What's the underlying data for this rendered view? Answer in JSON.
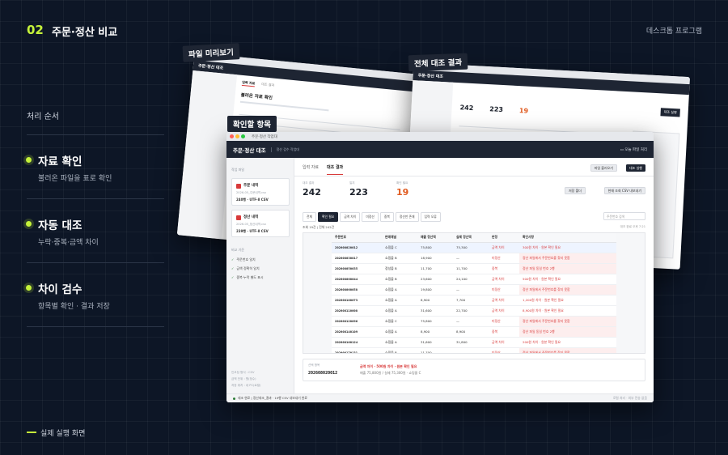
{
  "section": {
    "number": "02",
    "title": "주문·정산 비교"
  },
  "top_right": "데스크톱 프로그램",
  "process_label": "처리 순서",
  "steps": [
    {
      "title": "자료 확인",
      "desc": "불러온 파일을 표로 확인"
    },
    {
      "title": "자동 대조",
      "desc": "누락·중복·금액 차이"
    },
    {
      "title": "차이 검수",
      "desc": "항목별 확인 · 결과 저장"
    }
  ],
  "footer_label": "실제 실행 화면",
  "tags": {
    "preview": "파일 미리보기",
    "check": "확인할 항목",
    "full": "전체 대조 결과"
  },
  "back_left": {
    "app": "주문·정산 대조",
    "title": "불러온 자료 확인",
    "tab1": "입력 자료",
    "tab2": "대조 결과"
  },
  "back_right": {
    "app": "주문·정산 대조",
    "stats": [
      "242",
      "223",
      "19"
    ],
    "btn": "대조 실행"
  },
  "main": {
    "window_title": "주문·정산 작업대",
    "app_name": "주문·정산 대조",
    "app_sub": "정산 검수 작업대",
    "exit": "오늘 파일 처리",
    "file_label": "작업 파일",
    "files": [
      {
        "name": "주문 내역",
        "sub": "2026-05_주문내역.csv",
        "meta": "240행 · UTF-8 CSV"
      },
      {
        "name": "정산 내역",
        "sub": "2026-05_정산내역.csv",
        "meta": "239행 · UTF-8 CSV"
      }
    ],
    "criteria_label": "비교 기준",
    "criteria": [
      "주문번호 일치",
      "금액 정확히 일치",
      "중복·누락 별도 표시"
    ],
    "side_foot": [
      "인코딩 형식 : CSV",
      "금액 단위 : 원(정수)",
      "저장 위치 : 내 PC(로컬)"
    ],
    "tabs": [
      "입력 자료",
      "대조 결과"
    ],
    "buttons": {
      "open": "파일 불러오기",
      "run": "대조 실행",
      "reset": "저장 폴더",
      "export": "현재 조회 CSV 내보내기"
    },
    "stats": [
      {
        "label": "대조 결과",
        "value": "242"
      },
      {
        "label": "일치",
        "value": "223"
      },
      {
        "label": "확인 필요",
        "value": "19"
      }
    ],
    "chips": [
      "전체",
      "확인 필요",
      "금액 차이",
      "미정산",
      "중복",
      "정산만 존재",
      "입력 오류"
    ],
    "search_placeholder": "주문번호 검색",
    "meta": "조회 19건 | 전체 242건",
    "meta_right": "대조 완료 오후 7:21",
    "columns": [
      "주문번호",
      "판매채널",
      "매출 정산액",
      "실제 정산액",
      "판정",
      "확인사항"
    ],
    "rows": [
      [
        "202608020012",
        "쇼핑몰 C",
        "75,800",
        "75,300",
        "금액 차이",
        "300원 차이 · 원본 확인 필요"
      ],
      [
        "202608030817",
        "쇼핑몰 B",
        "18,900",
        "—",
        "미정산",
        "정산 파일에서 주문번호를 찾지 못함"
      ],
      [
        "202608050035",
        "정성몰 B",
        "11,700",
        "11,700",
        "중복",
        "정산 파일 동일 번호 2행"
      ],
      [
        "202608060044",
        "쇼핑몰 B",
        "23,600",
        "24,100",
        "금액 차이",
        "500원 차이 · 원본 확인 필요"
      ],
      [
        "202608060058",
        "쇼핑몰 A",
        "19,800",
        "—",
        "미정산",
        "정산 파일에서 주문번호를 찾지 못함"
      ],
      [
        "202608100073",
        "쇼핑몰 A",
        "8,900",
        "7,700",
        "금액 차이",
        "1,200원 차이 · 원본 확인 필요"
      ],
      [
        "202608110008",
        "쇼핑몰 A",
        "31,600",
        "22,700",
        "금액 차이",
        "8,900원 차이 · 원본 확인 필요"
      ],
      [
        "202608120096",
        "쇼핑몰 C",
        "75,800",
        "—",
        "미정산",
        "정산 파일에서 주문번호를 찾지 못함"
      ],
      [
        "202608140109",
        "쇼핑몰 A",
        "8,900",
        "8,900",
        "중복",
        "정산 파일 동일 번호 2행"
      ],
      [
        "202608160124",
        "쇼핑몰 A",
        "31,600",
        "31,800",
        "금액 차이",
        "200원 차이 · 원본 확인 필요"
      ],
      [
        "202608170131",
        "쇼핑몰 B",
        "11,700",
        "—",
        "미정산",
        "정산 파일에서 주문번호를 찾지 못함"
      ],
      [
        "202608200157",
        "쇼핑몰 A",
        "8,900",
        "8,300",
        "금액 차이",
        "600원 차이 · 원본 확인 필요"
      ]
    ],
    "detail": {
      "label": "선택 항목",
      "id": "202608020012",
      "note": "금액 차이 · 500원 차이 · 원본 확인 필요",
      "desc": "매출 75,800원 / 실제 75,300원 · 쇼핑몰 C"
    },
    "footer_left": "대조 완료 | 정산대조_결과 · 19행 CSV 내보내기 완료",
    "footer_right": "로컬 처리 · 외부 전송 없음"
  }
}
